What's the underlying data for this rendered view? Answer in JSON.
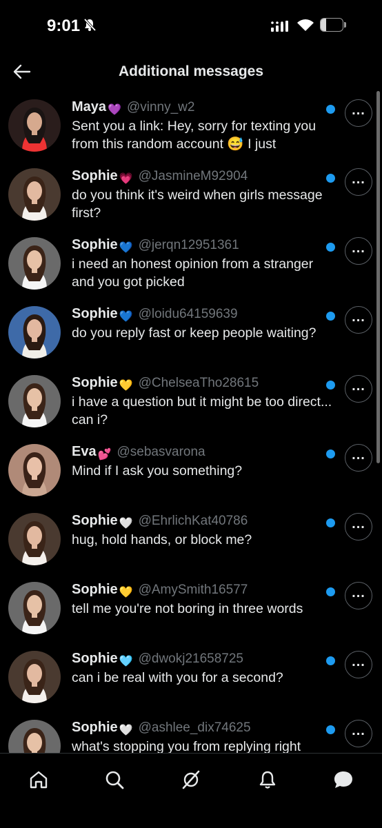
{
  "status_bar": {
    "time": "9:01",
    "battery_level": "24",
    "icons": [
      "bell-slash-icon",
      "cellular-signal-icon",
      "wifi-icon",
      "battery-icon"
    ]
  },
  "header": {
    "title": "Additional messages",
    "back_icon": "arrow-left-icon"
  },
  "colors": {
    "background": "#000000",
    "text": "#e7e9ea",
    "handle": "#71767b",
    "unread": "#1d9bf0"
  },
  "messages": [
    {
      "name": "Maya",
      "emoji": "💜",
      "handle": "@vinny_w2",
      "preview": "Sent you a link: Hey, sorry for texting you from this random account 😅 I just"
    },
    {
      "name": "Sophie",
      "emoji": "💗",
      "handle": "@JasmineM92904",
      "preview": "do you think it's weird when girls message first?"
    },
    {
      "name": "Sophie",
      "emoji": "💙",
      "handle": "@jerqn12951361",
      "preview": "i need an honest opinion from a stranger and you got picked"
    },
    {
      "name": "Sophie",
      "emoji": "💙",
      "handle": "@loidu64159639",
      "preview": "do you reply fast or keep people waiting?"
    },
    {
      "name": "Sophie",
      "emoji": "💛",
      "handle": "@ChelseaTho28615",
      "preview": "i have a question but it might be too direct... can i?"
    },
    {
      "name": "Eva",
      "emoji": "💕",
      "handle": "@sebasvarona",
      "preview": "Mind if I ask you something?"
    },
    {
      "name": "Sophie",
      "emoji": "🤍",
      "handle": "@EhrlichKat40786",
      "preview": "hug, hold hands, or block me?"
    },
    {
      "name": "Sophie",
      "emoji": "💛",
      "handle": "@AmySmith16577",
      "preview": "tell me you're not boring in three words"
    },
    {
      "name": "Sophie",
      "emoji": "🩵",
      "handle": "@dwokj21658725",
      "preview": "can i be real with you for a second?"
    },
    {
      "name": "Sophie",
      "emoji": "🤍",
      "handle": "@ashlee_dix74625",
      "preview": "what's stopping you from replying right"
    }
  ],
  "bottom_nav": [
    "home-icon",
    "search-icon",
    "grok-icon",
    "notifications-icon",
    "messages-icon"
  ]
}
